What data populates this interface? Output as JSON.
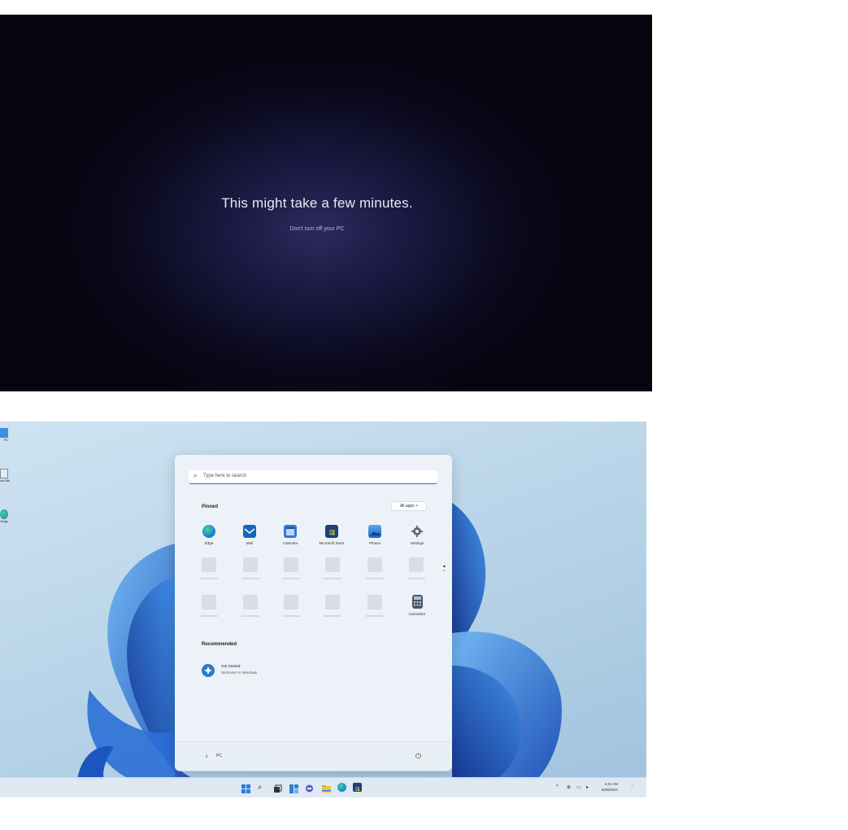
{
  "setup_screen": {
    "title": "This might take a few minutes.",
    "subtitle": "Don't turn off your PC"
  },
  "desktop": {
    "icons": [
      {
        "label": "PC",
        "icon": "this-pc-icon"
      },
      {
        "label": "Recycle Bin",
        "icon": "recycle-bin-icon"
      },
      {
        "label": "Microsoft Edge",
        "icon": "edge-icon"
      }
    ]
  },
  "start_menu": {
    "search_placeholder": "Type here to search",
    "pinned_label": "Pinned",
    "all_apps_label": "All apps  >",
    "pinned_apps": [
      {
        "label": "Edge",
        "icon": "edge-icon",
        "color": "#1a8bd6"
      },
      {
        "label": "Mail",
        "icon": "mail-icon",
        "color": "#1565b8"
      },
      {
        "label": "Calendar",
        "icon": "calendar-icon",
        "color": "#2e7bd3"
      },
      {
        "label": "Microsoft Store",
        "icon": "store-icon",
        "color": "#1e3f7a"
      },
      {
        "label": "Photos",
        "icon": "photos-icon",
        "color": "#2f82d6"
      },
      {
        "label": "Settings",
        "icon": "gear-icon",
        "color": "#5c6b7c"
      },
      {
        "label": "Calculator",
        "icon": "calculator-icon",
        "color": "#4b5561"
      }
    ],
    "recommended_label": "Recommended",
    "recommended": [
      {
        "title": "Get Started",
        "subtitle": "Welcome to Windows",
        "icon": "get-started-icon"
      }
    ],
    "user_name": "PC"
  },
  "taskbar": {
    "icons": [
      "windows-start-icon",
      "search-icon",
      "task-view-icon",
      "widgets-icon",
      "chat-icon",
      "file-explorer-icon",
      "edge-icon",
      "store-icon"
    ],
    "tray_icons": [
      "chevron-up-icon",
      "network-icon",
      "volume-icon",
      "battery-icon"
    ],
    "time": "4:41 AM",
    "date": "6/28/2022"
  },
  "colors": {
    "accent": "#1f6fc4",
    "setup_bg": "#0b0a1e"
  }
}
